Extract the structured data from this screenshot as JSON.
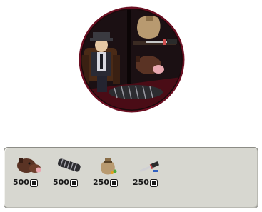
{
  "hero_scene": {
    "description_icon": "prize-scene-illustration"
  },
  "rewards": {
    "currency_icon": "coin-icon",
    "items": [
      {
        "icon": "animal-head-icon",
        "amount": "500"
      },
      {
        "icon": "wrapped-bundle-icon",
        "amount": "500"
      },
      {
        "icon": "money-sack-icon",
        "amount": "250"
      },
      {
        "icon": "knife-icon",
        "amount": "250"
      }
    ]
  },
  "colors": {
    "panel_bg": "#d7d7d0",
    "panel_border": "#8c8c86",
    "circle_ring": "#6b0f22",
    "amount_text": "#1a1a1a"
  }
}
